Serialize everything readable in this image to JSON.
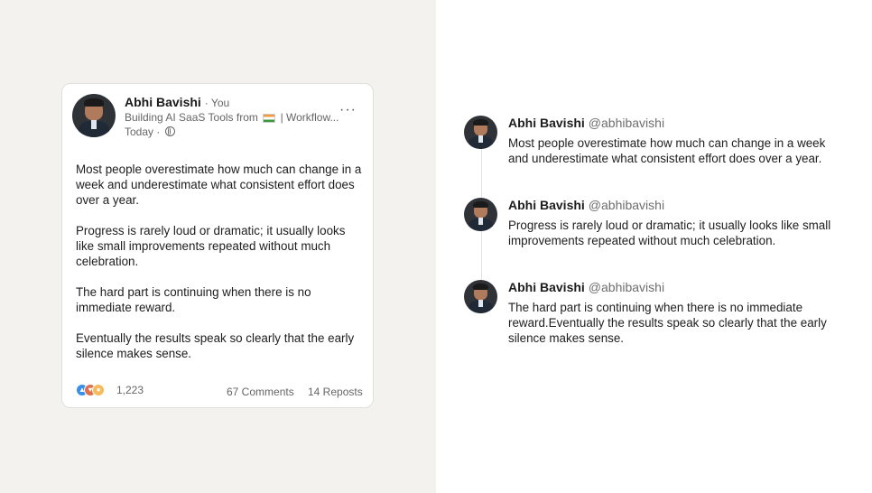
{
  "linkedin_post": {
    "author_name": "Abhi Bavishi",
    "you_label": "· You",
    "headline_before_flag": "Building AI SaaS Tools from",
    "headline_after_flag": "| Workflow...",
    "time_label": "Today ·",
    "more_icon": "ellipsis-icon",
    "paragraphs": [
      "Most people overestimate how much can change in a week and underestimate what consistent effort does over a year.",
      "Progress is rarely loud or dramatic; it usually looks like small improvements repeated without much celebration.",
      "The hard part is continuing when there is no immediate reward.",
      "Eventually the results speak so clearly that the early silence makes sense."
    ],
    "reaction_count": "1,223",
    "comments_label": "67 Comments",
    "reposts_label": "14 Reposts"
  },
  "thread": {
    "tweets": [
      {
        "name": "Abhi Bavishi",
        "handle": "@abhibavishi",
        "text": "Most people overestimate how much can change in a week and underestimate what consistent effort does over a year."
      },
      {
        "name": "Abhi Bavishi",
        "handle": "@abhibavishi",
        "text": "Progress is rarely loud or dramatic; it usually looks like small improvements repeated without much celebration."
      },
      {
        "name": "Abhi Bavishi",
        "handle": "@abhibavishi",
        "text": "The hard part is continuing when there is no immediate reward.Eventually the results speak so clearly that the early silence makes sense."
      }
    ]
  },
  "colors": {
    "left_background": "#f3f2ef",
    "right_background": "#ffffff",
    "like_blue": "#378fe9",
    "love_red": "#df704d",
    "insight_yellow": "#f5bb5c"
  }
}
